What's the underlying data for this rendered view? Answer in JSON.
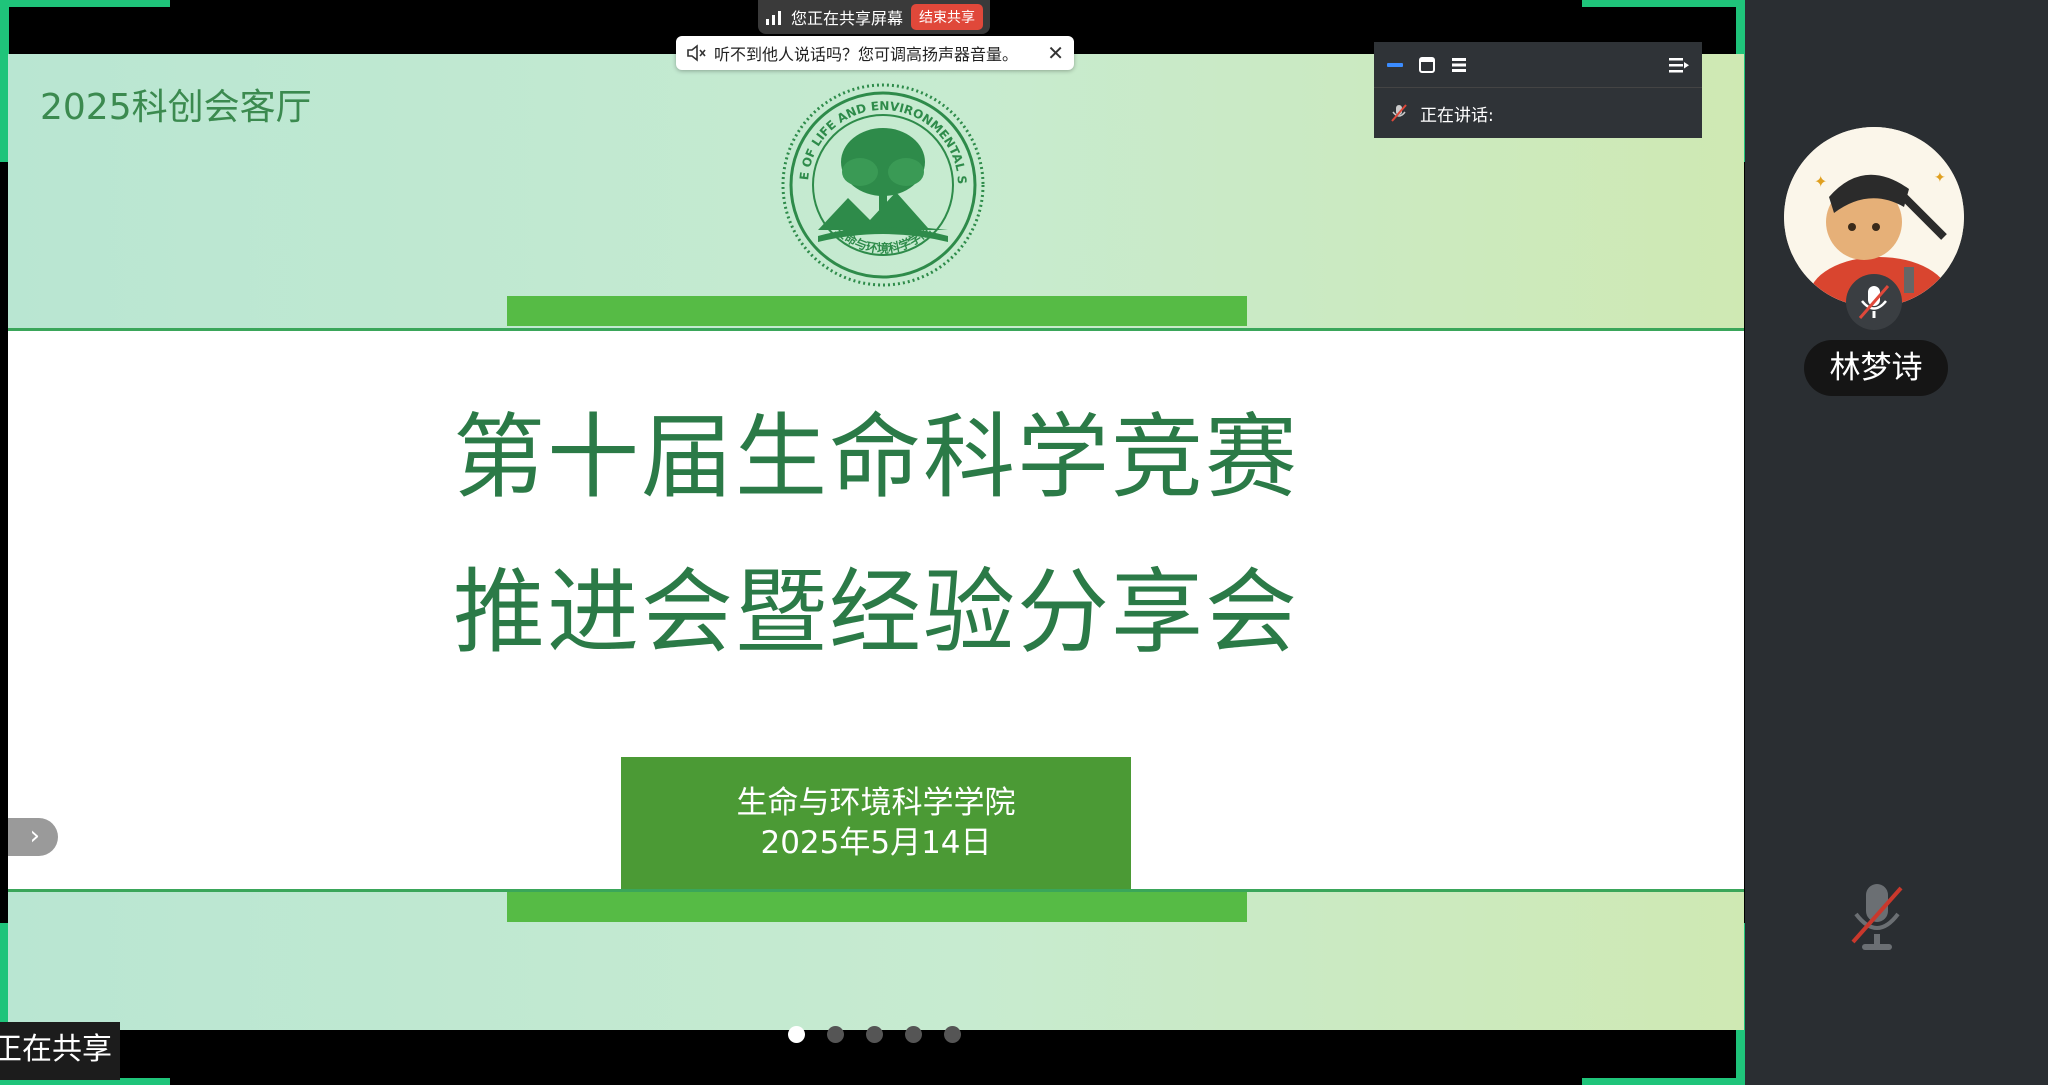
{
  "share_bar": {
    "status_text": "您正在共享屏幕",
    "stop_label": "结束共享"
  },
  "audio_tip": {
    "message": "听不到他人说话吗？您可调高扬声器音量。"
  },
  "mini_panel": {
    "speaking_label": "正在讲话:"
  },
  "slide": {
    "brand": "2025科创会客厅",
    "emblem": {
      "text_en": "COLLEGE OF LIFE AND ENVIRONMENTAL SCIENCE",
      "text_cn": "生命与环境科学学院"
    },
    "title_line1": "第十届生命科学竞赛",
    "title_line2": "推进会暨经验分享会",
    "org": "生命与环境科学学院",
    "date": "2025年5月14日",
    "page_count": 5,
    "active_page": 1
  },
  "sharing_label": "正在共享",
  "participant": {
    "name": "林梦诗",
    "muted": true
  },
  "colors": {
    "accent": "#1fc47a",
    "title_green": "#2b7a47",
    "box_green": "#4b9a35",
    "bar_green": "#56bb45",
    "stop_red": "#e0483a"
  }
}
